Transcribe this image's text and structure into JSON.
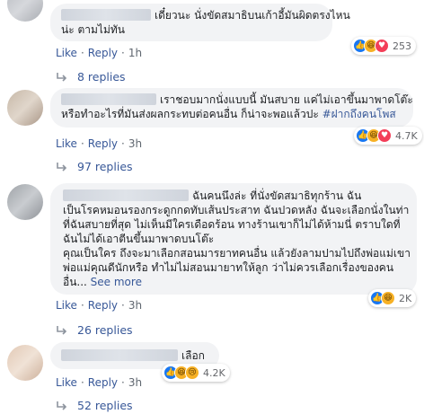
{
  "comments": [
    {
      "lines": [
        "เดี๋ยวนะ นั่งขัดสมาธิบนเก้าอี้มันผิดตรงไหน",
        "น่ะ ตามไม่ทัน"
      ],
      "reactions": [
        "like",
        "haha",
        "love"
      ],
      "reaction_count": "253",
      "actions": {
        "like": "Like",
        "reply": "Reply",
        "time": "1h"
      },
      "replies_label": "8 replies"
    },
    {
      "lines": [
        "เราชอบมากนั่งแบบนี้ มันสบาย แค่ไม่เอาขึ้นมาพาดโต๊ะ",
        "หรือทำอะไรที่มันส่งผลกระทบต่อคนอื่น ก็น่าจะพอแล้วปะ "
      ],
      "hashtag": "#ฝากถึงคนโพส",
      "reactions": [
        "like",
        "haha",
        "love"
      ],
      "reaction_count": "4.7K",
      "actions": {
        "like": "Like",
        "reply": "Reply",
        "time": "3h"
      },
      "replies_label": "97 replies"
    },
    {
      "lines": [
        "ฉันคนนึงล่ะ ที่นั่งขัดสมาธิทุกร้าน ฉัน",
        "เป็นโรคหมอนรองกระดูกกดทับเส้นประสาท ฉันปวดหลัง ฉันจะเลือกนั่งในท่า",
        "ที่ฉันสบายที่สุด ไม่เห็นมีใครเดือดร้อน ทางร้านเขาก็ไม่ได้ห้ามนี่ ตราบใดที่",
        "ฉันไม่ได้เอาตีนขึ้นมาพาดบนโต๊ะ",
        "คุณเป็นใคร ถึงจะมาเลือกสอนมารยาทคนอื่น แล้วยังลามปามไปถึงพ่อแม่เขา",
        "พ่อแม่คุณดีนักหรือ ทำไม่ไม่สอนมายาทให้ลูก ว่าไม่ควรเลือกเรื่องของคน",
        "อื่น... "
      ],
      "see_more": "See more",
      "reactions": [
        "like",
        "haha"
      ],
      "reaction_count": "2K",
      "actions": {
        "like": "Like",
        "reply": "Reply",
        "time": "3h"
      },
      "replies_label": "26 replies"
    },
    {
      "lines": [
        "เลือก"
      ],
      "reactions": [
        "like",
        "haha",
        "sad"
      ],
      "reaction_count": "4.2K",
      "actions": {
        "like": "Like",
        "reply": "Reply",
        "time": "3h"
      },
      "replies_label": "52 replies"
    }
  ],
  "colors": {
    "link": "#385898",
    "bubble": "#f2f3f5",
    "meta": "#606770"
  }
}
